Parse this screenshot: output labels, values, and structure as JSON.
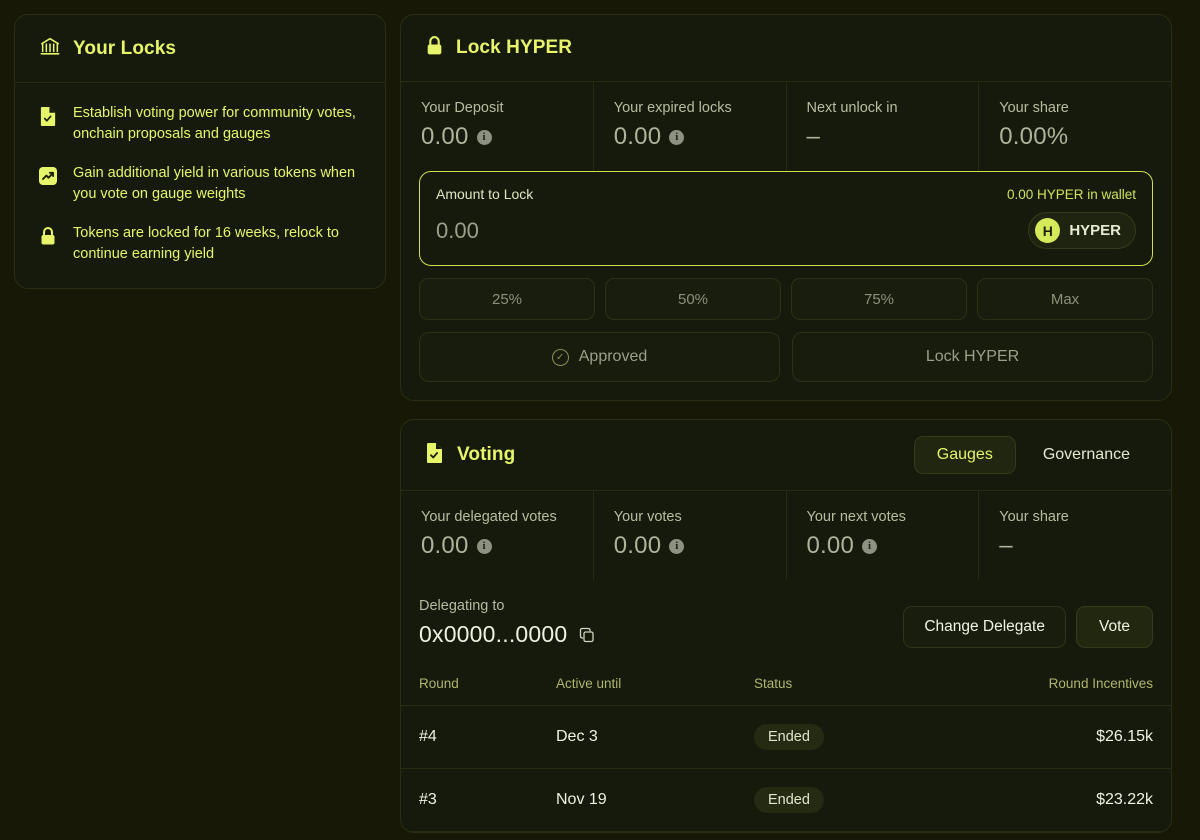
{
  "locks_panel": {
    "title": "Your Locks",
    "icon": "bank-icon",
    "bullets": [
      {
        "icon": "document-check-icon",
        "text": "Establish voting power for community votes, onchain proposals and gauges"
      },
      {
        "icon": "trending-up-icon",
        "text": "Gain additional yield in various tokens when you vote on gauge weights"
      },
      {
        "icon": "lock-icon",
        "text": "Tokens are locked for 16 weeks, relock to continue earning yield"
      }
    ]
  },
  "lock_panel": {
    "title": "Lock HYPER",
    "icon": "lock-icon",
    "stats": [
      {
        "label": "Your Deposit",
        "value": "0.00",
        "has_info": true
      },
      {
        "label": "Your expired locks",
        "value": "0.00",
        "has_info": true
      },
      {
        "label": "Next unlock in",
        "value": "–",
        "has_info": false
      },
      {
        "label": "Your share",
        "value": "0.00%",
        "has_info": false
      }
    ],
    "amount": {
      "label": "Amount to Lock",
      "wallet_balance": "0.00 HYPER in wallet",
      "input_value": "0.00",
      "input_placeholder": "0.00",
      "token_symbol": "HYPER",
      "token_logo_letter": "H"
    },
    "percent_buttons": [
      "25%",
      "50%",
      "75%",
      "Max"
    ],
    "approve_label": "Approved",
    "lock_label": "Lock HYPER"
  },
  "voting_panel": {
    "title": "Voting",
    "icon": "document-check-icon",
    "tabs": [
      {
        "label": "Gauges",
        "active": true
      },
      {
        "label": "Governance",
        "active": false
      }
    ],
    "stats": [
      {
        "label": "Your delegated votes",
        "value": "0.00",
        "has_info": true
      },
      {
        "label": "Your votes",
        "value": "0.00",
        "has_info": true
      },
      {
        "label": "Your next votes",
        "value": "0.00",
        "has_info": true
      },
      {
        "label": "Your share",
        "value": "–",
        "has_info": false
      }
    ],
    "delegating": {
      "label": "Delegating to",
      "address": "0x0000...0000",
      "copy_icon": "copy-icon",
      "change_delegate_label": "Change Delegate",
      "vote_label": "Vote"
    },
    "table": {
      "columns": [
        "Round",
        "Active until",
        "Status",
        "Round Incentives"
      ],
      "rows": [
        {
          "round": "#4",
          "active_until": "Dec 3",
          "status": "Ended",
          "incentives": "$26.15k"
        },
        {
          "round": "#3",
          "active_until": "Nov 19",
          "status": "Ended",
          "incentives": "$23.22k"
        }
      ]
    }
  },
  "colors": {
    "page_bg": "#181807",
    "panel_bg": "#151a0c",
    "accent": "#e6f56a",
    "muted": "#9ba08a",
    "border": "#262b12"
  }
}
